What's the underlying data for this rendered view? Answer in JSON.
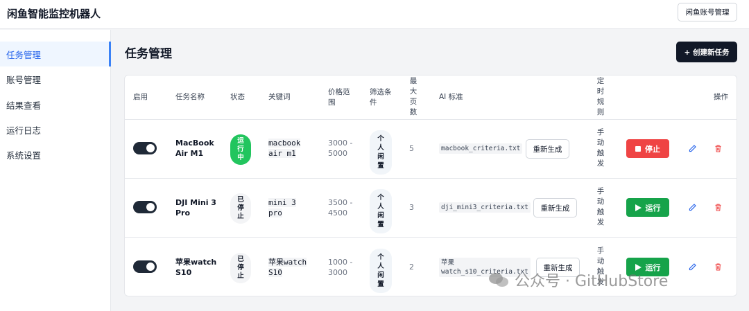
{
  "app": {
    "title": "闲鱼智能监控机器人",
    "account_button": "闲鱼账号管理"
  },
  "sidebar": {
    "items": [
      {
        "label": "任务管理",
        "active": true
      },
      {
        "label": "账号管理",
        "active": false
      },
      {
        "label": "结果查看",
        "active": false
      },
      {
        "label": "运行日志",
        "active": false
      },
      {
        "label": "系统设置",
        "active": false
      }
    ]
  },
  "main": {
    "title": "任务管理",
    "create_button": "+ 创建新任务",
    "columns": {
      "enabled": "启用",
      "name": "任务名称",
      "status": "状态",
      "keyword": "关键词",
      "price": [
        "价格范",
        "围"
      ],
      "filter": [
        "筛选条",
        "件"
      ],
      "max_pages": [
        "最",
        "大",
        "页",
        "数"
      ],
      "ai": "AI 标准",
      "schedule": [
        "定",
        "时",
        "规",
        "则"
      ],
      "actions": "操作"
    },
    "tasks": [
      {
        "enabled": true,
        "name": [
          "MacBook",
          "Air M1"
        ],
        "status": [
          "运",
          "行",
          "中"
        ],
        "status_type": "running",
        "keyword": [
          "macbook",
          "air m1"
        ],
        "price": [
          "3000 -",
          "5000"
        ],
        "filter": [
          "个",
          "人",
          "闲",
          "置"
        ],
        "max_pages": "5",
        "criteria": [
          "macbook_criteria.txt"
        ],
        "regen_label": "重新生成",
        "schedule": [
          "手",
          "动",
          "触",
          "发"
        ],
        "action_label": "停止",
        "action_type": "stop"
      },
      {
        "enabled": true,
        "name": [
          "DJI Mini 3",
          "Pro"
        ],
        "status": [
          "已",
          "停",
          "止"
        ],
        "status_type": "stopped",
        "keyword": [
          "mini 3",
          "pro"
        ],
        "price": [
          "3500 -",
          "4500"
        ],
        "filter": [
          "个",
          "人",
          "闲",
          "置"
        ],
        "max_pages": "3",
        "criteria": [
          "dji_mini3_criteria.txt"
        ],
        "regen_label": "重新生成",
        "schedule": [
          "手",
          "动",
          "触",
          "发"
        ],
        "action_label": "运行",
        "action_type": "run"
      },
      {
        "enabled": true,
        "name": [
          "苹果watch",
          "S10"
        ],
        "status": [
          "已",
          "停",
          "止"
        ],
        "status_type": "stopped",
        "keyword": [
          "苹果watch",
          "S10"
        ],
        "price": [
          "1000 -",
          "3000"
        ],
        "filter": [
          "个",
          "人",
          "闲",
          "置"
        ],
        "max_pages": "2",
        "criteria": [
          "苹果",
          "watch_s10_criteria.txt"
        ],
        "regen_label": "重新生成",
        "schedule": [
          "手",
          "动",
          "触",
          "发"
        ],
        "action_label": "运行",
        "action_type": "run"
      }
    ]
  },
  "watermark": "公众号 · GitHubStore",
  "colors": {
    "primary": "#2563eb",
    "running": "#22c55e",
    "stop": "#ef4444",
    "run": "#16a34a",
    "dark": "#111827"
  }
}
